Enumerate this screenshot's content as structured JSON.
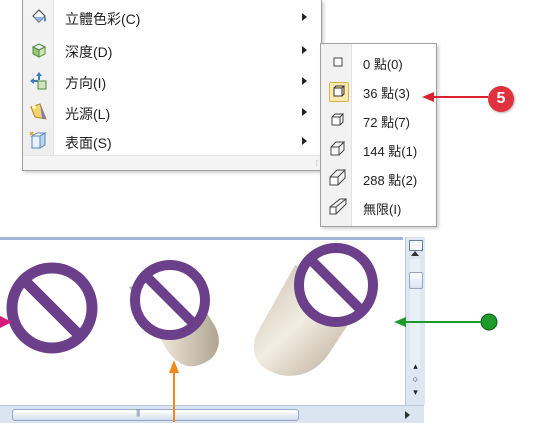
{
  "menu": {
    "items": [
      {
        "label": "立體色彩(C)",
        "icon": "color-3d-icon"
      },
      {
        "label": "深度(D)",
        "icon": "depth-icon"
      },
      {
        "label": "方向(I)",
        "icon": "direction-icon"
      },
      {
        "label": "光源(L)",
        "icon": "lighting-icon"
      },
      {
        "label": "表面(S)",
        "icon": "surface-icon"
      }
    ]
  },
  "depth_menu": {
    "items": [
      {
        "label": "0 點(0)",
        "highlighted": false
      },
      {
        "label": "36 點(3)",
        "highlighted": true
      },
      {
        "label": "72 點(7)",
        "highlighted": false
      },
      {
        "label": "144 點(1)",
        "highlighted": false
      },
      {
        "label": "288 點(2)",
        "highlighted": false
      },
      {
        "label": "無限(I)",
        "highlighted": false
      }
    ]
  },
  "annotations": {
    "step_number": "5",
    "arrow_colors": {
      "red": "#d9222f",
      "green": "#1e9a2d",
      "orange": "#f08a1c",
      "pink": "#d61b7a"
    }
  },
  "colors": {
    "symbol_purple": "#6c3f8a",
    "cylinder_body": "#d9cebc",
    "scrollbar": "#dbe5f1"
  }
}
